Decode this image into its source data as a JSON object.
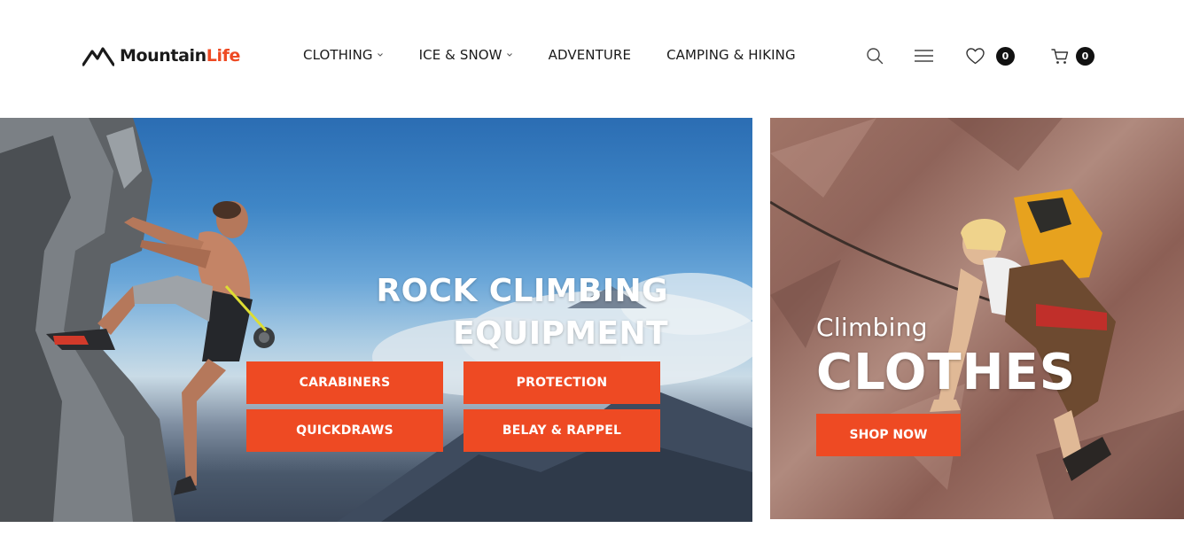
{
  "header": {
    "logo": {
      "word1": "Mountain",
      "word2": "Life",
      "icon": "mountain-logo-icon"
    },
    "nav": [
      {
        "label": "CLOTHING",
        "has_dropdown": true
      },
      {
        "label": "ICE & SNOW",
        "has_dropdown": true
      },
      {
        "label": "ADVENTURE",
        "has_dropdown": false
      },
      {
        "label": "CAMPING & HIKING",
        "has_dropdown": false
      }
    ],
    "tools": {
      "search_icon": "search-icon",
      "menu_icon": "hamburger-menu-icon",
      "wishlist": {
        "icon": "heart-icon",
        "count": "0"
      },
      "cart": {
        "icon": "cart-icon",
        "count": "0"
      }
    }
  },
  "banner_left": {
    "title_line1": "ROCK CLIMBING",
    "title_line2": "EQUIPMENT",
    "buttons": [
      "CARABINERS",
      "PROTECTION",
      "QUICKDRAWS",
      "BELAY & RAPPEL"
    ]
  },
  "banner_right": {
    "subtitle": "Climbing",
    "title": "CLOTHES",
    "button": "SHOP NOW"
  },
  "colors": {
    "accent": "#ee4a23",
    "text": "#1a1a1a",
    "badge": "#111111",
    "background": "#ffffff"
  }
}
